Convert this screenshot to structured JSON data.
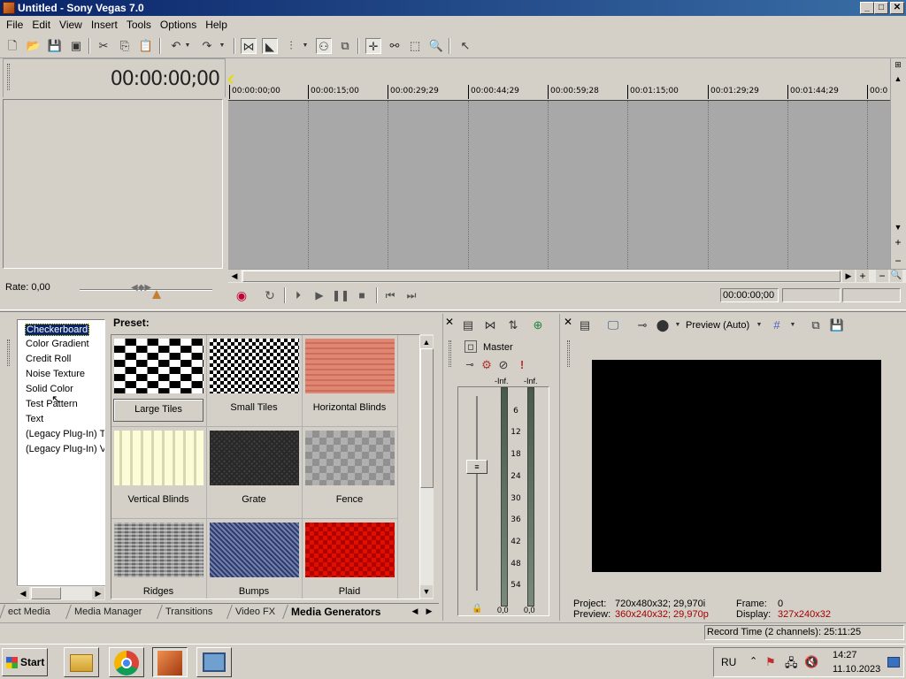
{
  "window": {
    "title": "Untitled - Sony Vegas 7.0",
    "minimize": "_",
    "maximize": "□",
    "close": "✕"
  },
  "menu": [
    "File",
    "Edit",
    "View",
    "Insert",
    "Tools",
    "Options",
    "Help"
  ],
  "timeline": {
    "timecode": "00:00:00;00",
    "ruler": [
      "00:00:00;00",
      "00:00:15;00",
      "00:00:29;29",
      "00:00:44;29",
      "00:00:59;28",
      "00:01:15;00",
      "00:01:29;29",
      "00:01:44;29",
      "00:0"
    ]
  },
  "rate": {
    "label": "Rate: 0,00"
  },
  "transport": {
    "timecode": "00:00:00;00"
  },
  "generators": {
    "items": [
      "Checkerboard",
      "Color Gradient",
      "Credit Roll",
      "Noise Texture",
      "Solid Color",
      "Test Pattern",
      "Text",
      "(Legacy Plug-In) T",
      "(Legacy Plug-In) V"
    ],
    "selected": "Checkerboard"
  },
  "presets": {
    "label": "Preset:",
    "items": [
      "Large Tiles",
      "Small Tiles",
      "Horizontal Blinds",
      "Vertical Blinds",
      "Grate",
      "Fence",
      "Ridges",
      "Bumps",
      "Plaid"
    ]
  },
  "tabs": [
    "ect Media",
    "Media Manager",
    "Transitions",
    "Video FX",
    "Media Generators"
  ],
  "mixer": {
    "label": "Master",
    "inf_left": "-Inf.",
    "inf_right": "-Inf.",
    "scale": [
      "6",
      "12",
      "18",
      "24",
      "30",
      "36",
      "42",
      "48",
      "54"
    ],
    "val_left": "0,0",
    "val_right": "0,0"
  },
  "preview": {
    "mode": "Preview (Auto)",
    "project_label": "Project:",
    "project_value": "720x480x32; 29,970i",
    "preview_label": "Preview:",
    "preview_value": "360x240x32; 29,970p",
    "frame_label": "Frame:",
    "frame_value": "0",
    "display_label": "Display:",
    "display_value": "327x240x32"
  },
  "status": {
    "record_time": "Record Time (2 channels): 25:11:25"
  },
  "taskbar": {
    "start": "Start",
    "lang": "RU",
    "time": "14:27",
    "date": "11.10.2023"
  }
}
